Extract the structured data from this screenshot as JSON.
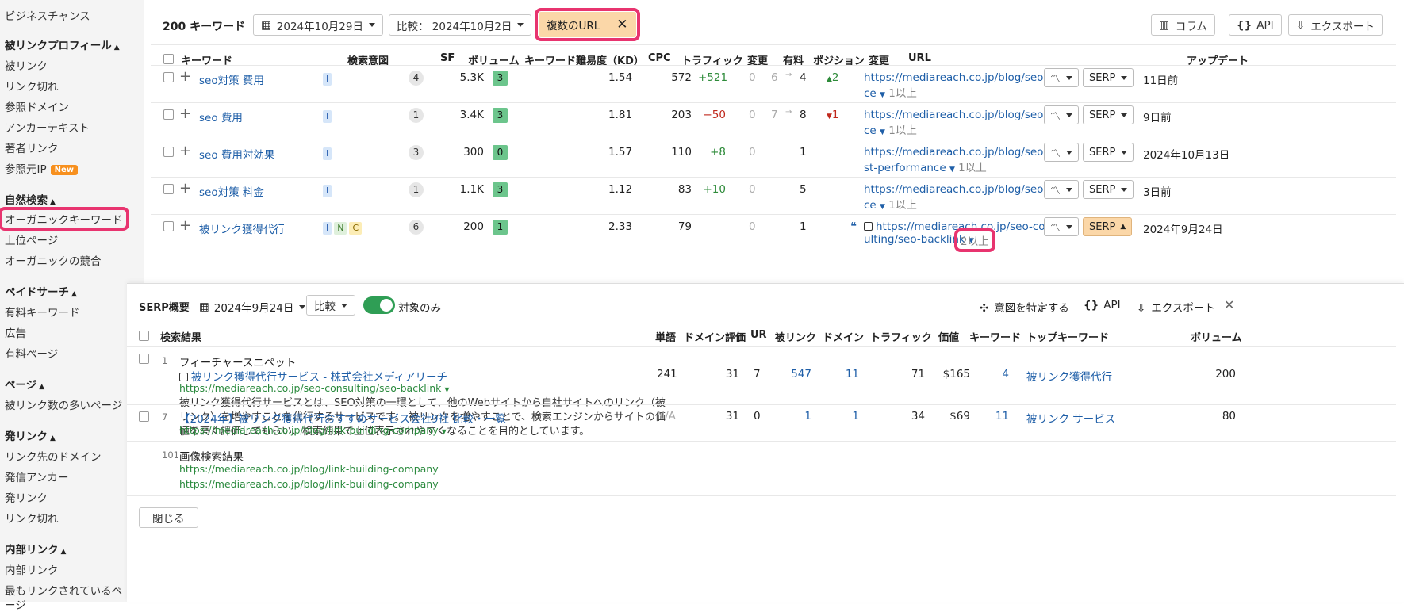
{
  "sidebar": {
    "top_item": "ビジネスチャンス",
    "sections": [
      {
        "title": "被リンクプロフィール",
        "items": [
          "被リンク",
          "リンク切れ",
          "参照ドメイン",
          "アンカーテキスト",
          "著者リンク",
          "参照元IP"
        ]
      },
      {
        "title": "自然検索",
        "items": [
          "オーガニックキーワード",
          "上位ページ",
          "オーガニックの競合"
        ]
      },
      {
        "title": "ペイドサーチ",
        "items": [
          "有料キーワード",
          "広告",
          "有料ページ"
        ]
      },
      {
        "title": "ページ",
        "items": [
          "被リンク数の多いページ"
        ]
      },
      {
        "title": "発リンク",
        "items": [
          "リンク先のドメイン",
          "発信アンカー",
          "発リンク",
          "リンク切れ"
        ]
      },
      {
        "title": "内部リンク",
        "items": [
          "内部リンク",
          "最もリンクされているペ",
          "ージ"
        ]
      }
    ],
    "new_badge": "New"
  },
  "toolbar": {
    "count_label": "200 キーワード",
    "date": "2024年10月29日",
    "compare": "比較： 2024年10月2日",
    "filter_chip": "複数のURL",
    "columns": "コラム",
    "api": "API",
    "export": "エクスポート"
  },
  "table": {
    "headers": [
      "キーワード",
      "検索意図",
      "SF",
      "ボリューム",
      "キーワード難易度（KD）",
      "CPC",
      "トラフィック",
      "変更",
      "有料",
      "ポジション",
      "変更",
      "URL",
      "アップデート"
    ],
    "rows": [
      {
        "keyword": "seo対策 費用",
        "intents": [
          "I"
        ],
        "sf": "4",
        "volume": "5.3K",
        "kd": "3",
        "cpc": "1.54",
        "traffic": "572",
        "change": "+521",
        "paid": "0",
        "pos_from": "6",
        "pos_to": "4",
        "pos_change": "2",
        "url1": "https://mediareach.co.jp/blog/seo-pri",
        "url2": "ce",
        "more": "1以上",
        "serp": "SERP",
        "update": "11日前"
      },
      {
        "keyword": "seo 費用",
        "intents": [
          "I"
        ],
        "sf": "1",
        "volume": "3.4K",
        "kd": "3",
        "cpc": "1.81",
        "traffic": "203",
        "change": "−50",
        "paid": "0",
        "pos_from": "7",
        "pos_to": "8",
        "pos_change": "1",
        "url1": "https://mediareach.co.jp/blog/seo-pri",
        "url2": "ce",
        "more": "1以上",
        "serp": "SERP",
        "update": "9日前"
      },
      {
        "keyword": "seo 費用対効果",
        "intents": [
          "I"
        ],
        "sf": "3",
        "volume": "300",
        "kd": "0",
        "cpc": "1.57",
        "traffic": "110",
        "change": "+8",
        "paid": "0",
        "pos_from": "",
        "pos_to": "1",
        "pos_change": "",
        "url1": "https://mediareach.co.jp/blog/seo-co",
        "url2": "st-performance",
        "more": "1以上",
        "serp": "SERP",
        "update": "2024年10月13日"
      },
      {
        "keyword": "seo対策 料金",
        "intents": [
          "I"
        ],
        "sf": "1",
        "volume": "1.1K",
        "kd": "3",
        "cpc": "1.12",
        "traffic": "83",
        "change": "+10",
        "paid": "0",
        "pos_from": "",
        "pos_to": "5",
        "pos_change": "",
        "url1": "https://mediareach.co.jp/blog/seo-pri",
        "url2": "ce",
        "more": "1以上",
        "serp": "SERP",
        "update": "3日前"
      },
      {
        "keyword": "被リンク獲得代行",
        "intents": [
          "I",
          "N",
          "C"
        ],
        "sf": "6",
        "volume": "200",
        "kd": "1",
        "cpc": "2.33",
        "traffic": "79",
        "change": "",
        "paid": "0",
        "pos_from": "",
        "pos_to": "1",
        "pos_change": "",
        "url1": "https://mediareach.co.jp/seo-cons",
        "url2": "ulting/seo-backlink",
        "more": "2以上",
        "serp": "SERP",
        "update": "2024年9月24日"
      }
    ]
  },
  "serp": {
    "title": "SERP概要",
    "date": "2024年9月24日",
    "compare": "比較",
    "toggle_label": "対象のみ",
    "identify_intent": "意図を特定する",
    "api": "API",
    "export": "エクスポート",
    "headers": [
      "検索結果",
      "単語",
      "ドメイン評価",
      "UR",
      "被リンク",
      "ドメイン",
      "トラフィック",
      "価値",
      "キーワード",
      "トップキーワード",
      "ボリューム"
    ],
    "results": [
      {
        "rank": "1",
        "type_label": "フィーチャースニペット",
        "title": "被リンク獲得代行サービス - 株式会社メディアリーチ",
        "url": "https://mediareach.co.jp/seo-consulting/seo-backlink",
        "desc": [
          "被リンク獲得代行サービスとは、SEO対策の一環として、他のWebサイトから自社サイトへのリンク（被",
          "リンク）を増やすことを代行するサービスです。 被リンクを増やすことで、検索エンジンからサイトの価",
          "値を高く評価してもらい、検索結果で上位表示されやすくなることを目的としています。"
        ],
        "words": "241",
        "dr": "31",
        "ur": "7",
        "backlinks": "547",
        "domains": "11",
        "traffic": "71",
        "value": "$165",
        "keywords": "4",
        "top_keyword": "被リンク獲得代行",
        "volume": "200"
      },
      {
        "rank": "7",
        "title": "【2024年】被リンク獲得代行おすすめサービス会社9社 比較・一覧",
        "url": "https://mediareach.co.jp/blog/link-building-company",
        "words": "N/A",
        "dr": "31",
        "ur": "0",
        "backlinks": "1",
        "domains": "1",
        "traffic": "34",
        "value": "$69",
        "keywords": "11",
        "top_keyword": "被リンク サービス",
        "volume": "80"
      },
      {
        "rank": "101",
        "type_label": "画像検索結果",
        "urls": [
          "https://mediareach.co.jp/blog/link-building-company",
          "https://mediareach.co.jp/blog/link-building-company"
        ]
      }
    ],
    "close": "閉じる"
  }
}
